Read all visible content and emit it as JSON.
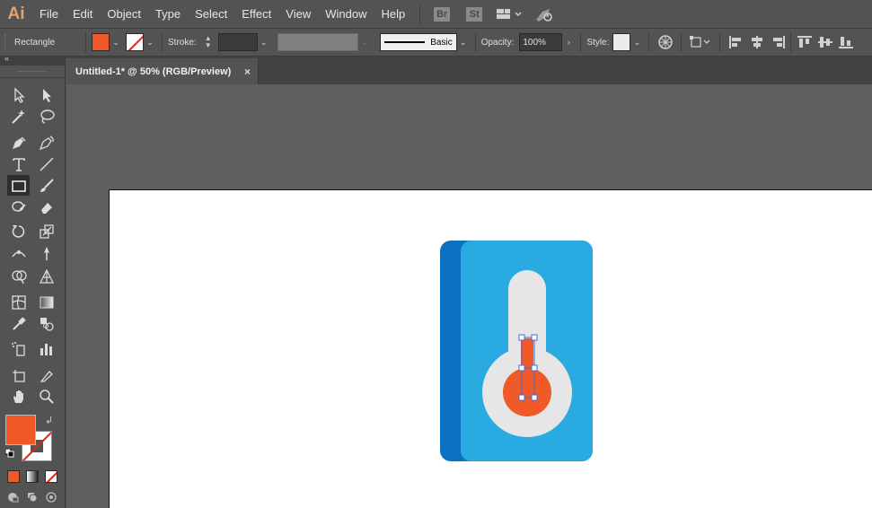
{
  "app": {
    "logo": "Ai"
  },
  "menu": [
    "File",
    "Edit",
    "Object",
    "Type",
    "Select",
    "Effect",
    "View",
    "Window",
    "Help"
  ],
  "appbar": {
    "bridge_label": "Br",
    "stock_label": "St"
  },
  "control": {
    "tool_name": "Rectangle",
    "stroke_label": "Stroke:",
    "brush_label": "Basic",
    "opacity_label": "Opacity:",
    "opacity_value": "100%",
    "style_label": "Style:",
    "fill_color": "#f05a28"
  },
  "document": {
    "tab_title": "Untitled-1* @ 50% (RGB/Preview)",
    "close_glyph": "×"
  },
  "colors": {
    "thermo_card_dark": "#0a72c0",
    "thermo_card_light": "#29abe2",
    "thermo_tube": "#e6e6e6",
    "thermo_mercury": "#f05a28",
    "selection": "#4a6cd4"
  },
  "tools": [
    [
      "selection-tool",
      "direct-selection-tool"
    ],
    [
      "magic-wand-tool",
      "lasso-tool"
    ],
    [
      "pen-tool",
      "curvature-tool"
    ],
    [
      "type-tool",
      "line-segment-tool"
    ],
    [
      "rectangle-tool",
      "paintbrush-tool"
    ],
    [
      "shaper-tool",
      "eraser-tool"
    ],
    [
      "rotate-tool",
      "scale-tool"
    ],
    [
      "width-tool",
      "free-transform-tool"
    ],
    [
      "shape-builder-tool",
      "perspective-grid-tool"
    ],
    [
      "mesh-tool",
      "gradient-tool"
    ],
    [
      "eyedropper-tool",
      "blend-tool"
    ],
    [
      "symbol-sprayer-tool",
      "column-graph-tool"
    ],
    [
      "artboard-tool",
      "slice-tool"
    ],
    [
      "hand-tool",
      "zoom-tool"
    ]
  ]
}
